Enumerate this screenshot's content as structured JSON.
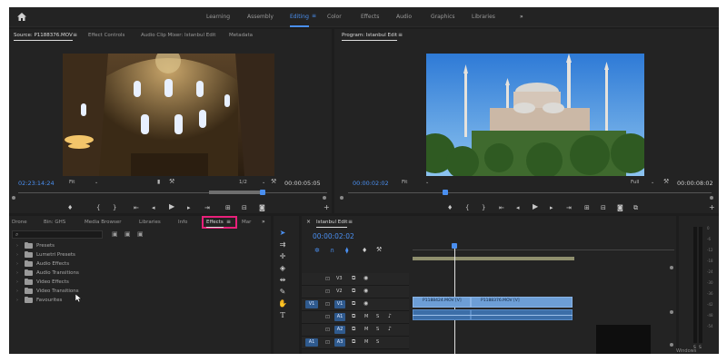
{
  "workspaces": [
    "Learning",
    "Assembly",
    "Editing",
    "Color",
    "Effects",
    "Audio",
    "Graphics",
    "Libraries"
  ],
  "active_workspace": "Editing",
  "more_symbol": "»",
  "home_icon": "home-icon",
  "source_panel": {
    "tabs": [
      "Source: P1188376.MOV",
      "Effect Controls",
      "Audio Clip Mixer: Istanbul Edit",
      "Metadata"
    ],
    "timecode": "02:23:14:24",
    "fit": "Fit",
    "zoom": "1/2",
    "duration": "00:00:05:05"
  },
  "program_panel": {
    "tab": "Program: Istanbul Edit",
    "timecode": "00:00:02:02",
    "fit": "Fit",
    "quality": "Full",
    "duration": "00:00:08:02"
  },
  "project_panel": {
    "tabs": [
      "Drone",
      "Bin: GHS",
      "Media Browser",
      "Libraries",
      "Info",
      "Effects",
      "Mar"
    ],
    "active_tab": "Effects",
    "search_placeholder": "",
    "folders": [
      "Presets",
      "Lumetri Presets",
      "Audio Effects",
      "Audio Transitions",
      "Video Effects",
      "Video Transitions",
      "Favourites"
    ]
  },
  "timeline": {
    "tab": "Istanbul Edit",
    "timecode": "00:00:02:02",
    "video_tracks": [
      "V3",
      "V2",
      "V1"
    ],
    "audio_tracks": [
      "A1",
      "A2",
      "A3"
    ],
    "source_patch_v": "V1",
    "source_patch_a": "A1",
    "clips": [
      "P1188424.MOV [V]",
      "P1188376.MOV [V]"
    ],
    "track_mute": "M",
    "track_solo": "S"
  },
  "audio_meter": {
    "ticks": [
      "0",
      "-6",
      "-12",
      "-18",
      "-24",
      "-30",
      "-36",
      "-42",
      "-48",
      "-54"
    ],
    "channels": [
      "S",
      "S"
    ]
  },
  "windows_watermark": "Windows",
  "colors": {
    "accent": "#4a8ff0",
    "highlight_box": "#e8207a",
    "clip_video": "#6d9ed6",
    "clip_audio": "#3c6ea8",
    "workarea_bar": "#8f8f6e"
  }
}
